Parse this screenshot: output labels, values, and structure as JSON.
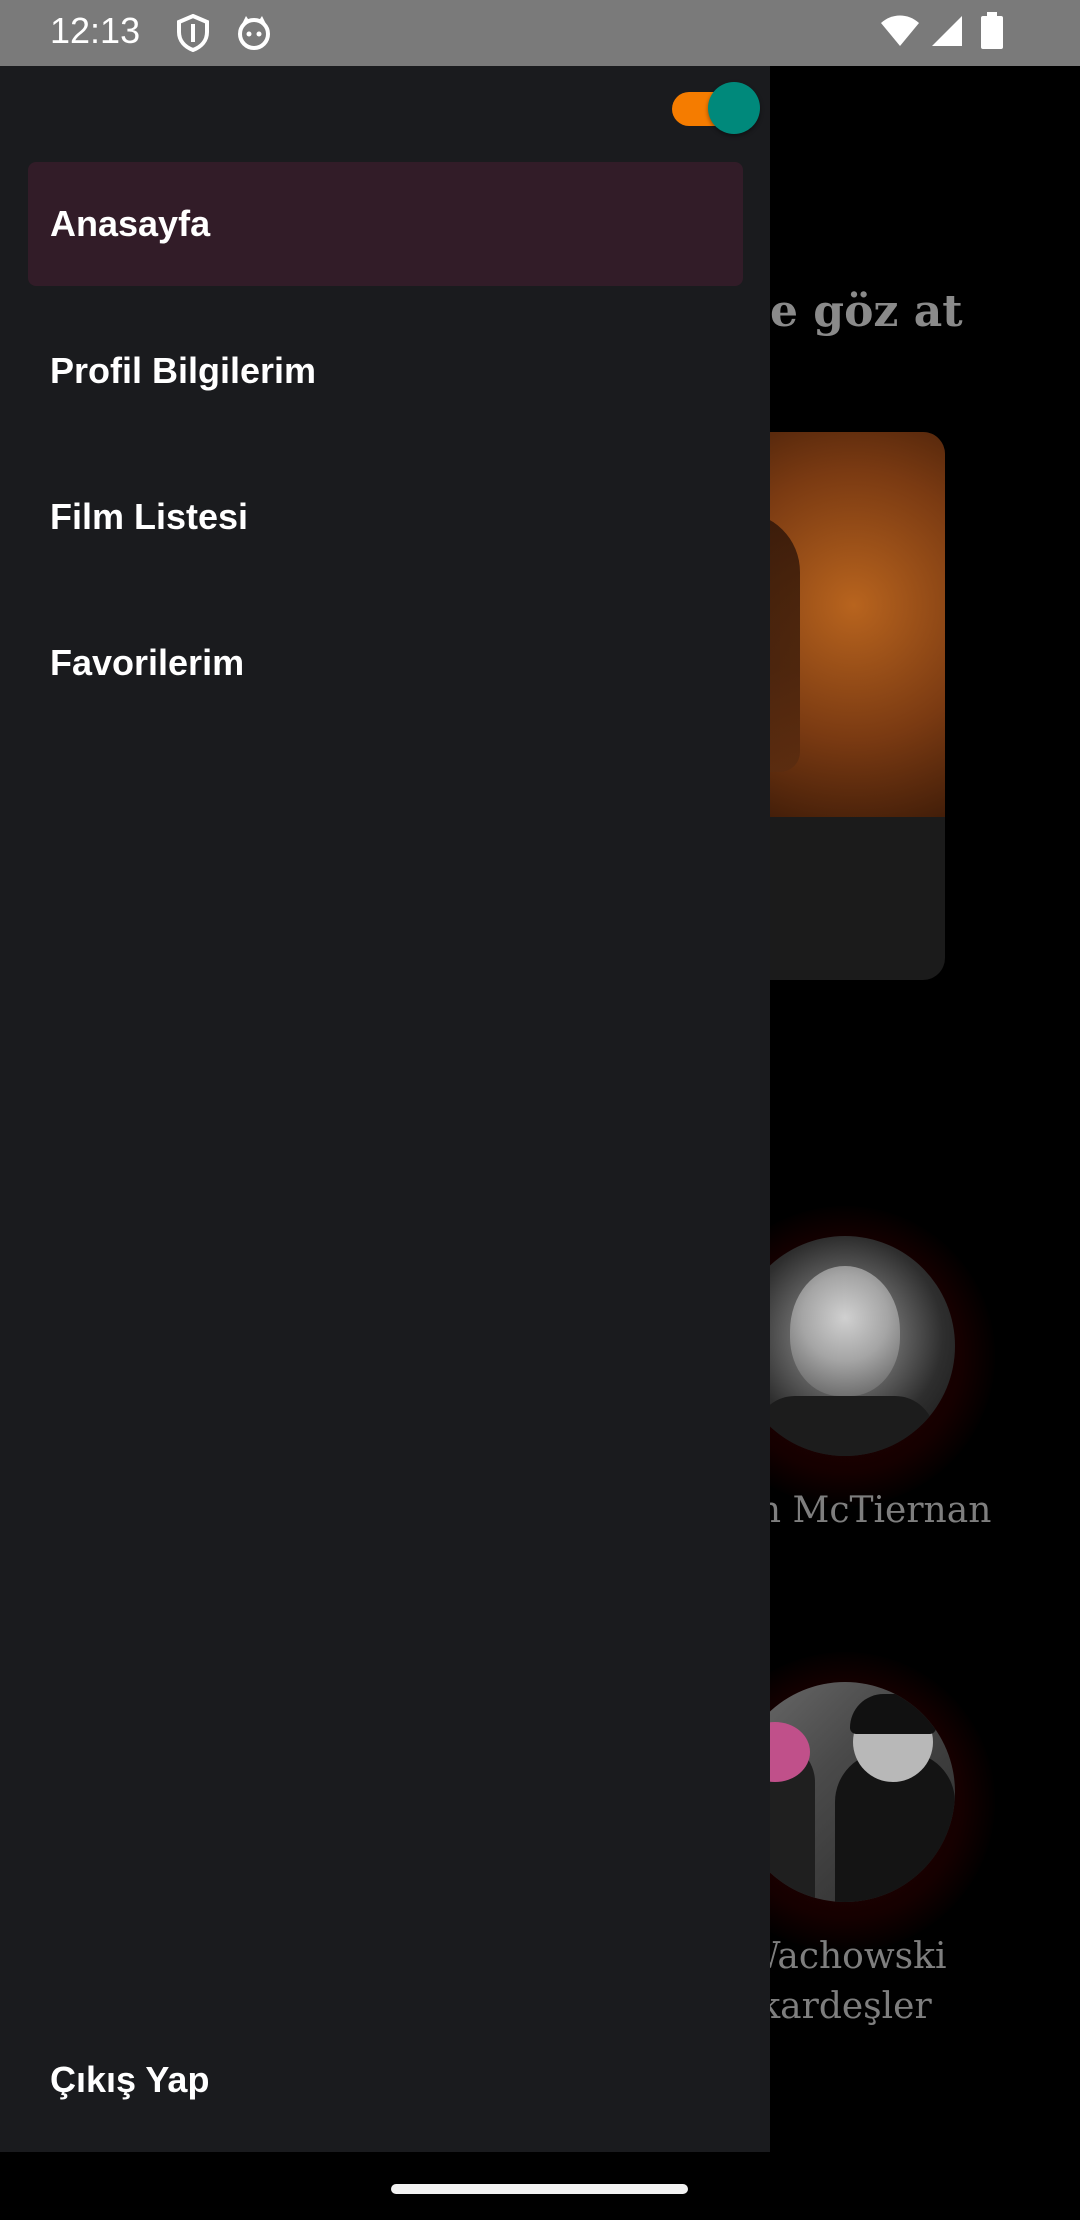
{
  "status_bar": {
    "time": "12:13",
    "icons": [
      "shield-icon",
      "cat-icon",
      "wifi-icon",
      "signal-icon",
      "battery-icon"
    ]
  },
  "background": {
    "heading": "ze göz at",
    "directors": [
      {
        "name": "John McTiernan"
      },
      {
        "name": "Wachowski kardeşler"
      }
    ]
  },
  "drawer": {
    "theme_toggle": {
      "on": true,
      "track_color": "#f57c00",
      "thumb_color": "#00897b"
    },
    "items": [
      {
        "label": "Anasayfa",
        "active": true
      },
      {
        "label": "Profil Bilgilerim",
        "active": false
      },
      {
        "label": "Film Listesi",
        "active": false
      },
      {
        "label": "Favorilerim",
        "active": false
      }
    ],
    "logout_label": "Çıkış Yap",
    "active_color": "#321c28",
    "background_color": "#1a1b1e"
  }
}
